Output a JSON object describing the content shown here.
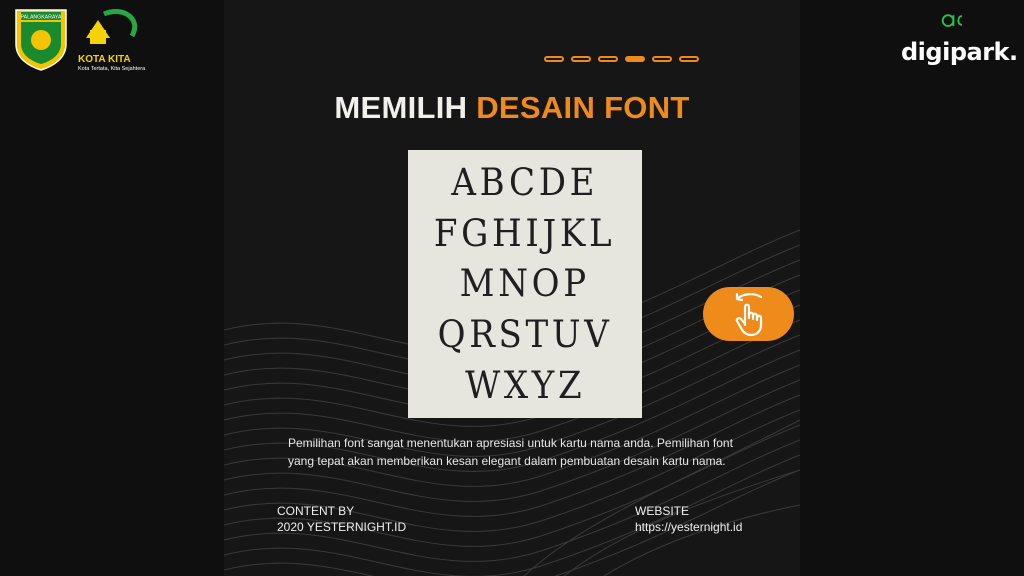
{
  "header": {
    "logo_left_text": "PALANGKARAYA",
    "kota_kita": {
      "name": "KOTA KITA",
      "tagline": "Kota Tertata, Kita Sejahtera"
    },
    "brand": "digipark.",
    "progress": {
      "total": 6,
      "active": 4
    }
  },
  "title": {
    "part1": "MEMILIH ",
    "part2": "DESAIN FONT"
  },
  "font_sample": {
    "rows": [
      "ABCDE",
      "FGHIJKL",
      "MNOP",
      "QRSTUV",
      "WXYZ"
    ]
  },
  "description": "Pemilihan font sangat menentukan apresiasi untuk kartu nama anda. Pemilihan font yang tepat akan memberikan kesan elegant dalam pembuatan desain kartu nama.",
  "footer": {
    "content_label": "CONTENT BY",
    "content_value": "2020 YESTERNIGHT.ID",
    "website_label": "WEBSITE",
    "website_value": "https://yesternight.id"
  },
  "colors": {
    "accent": "#ee8b1a",
    "background": "#0f0f0f",
    "card": "#e6e6df"
  },
  "icons": {
    "swipe": "swipe-hand-icon"
  }
}
